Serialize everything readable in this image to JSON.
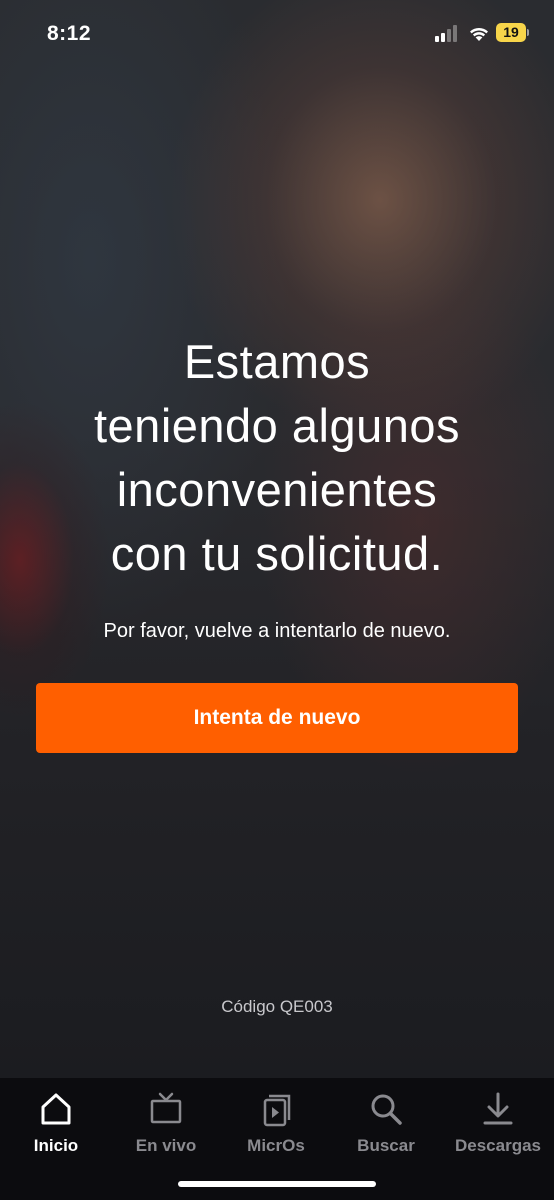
{
  "status_bar": {
    "time": "8:12",
    "battery_level": "19",
    "battery_color": "#f7d54a",
    "icons": [
      "cellular-signal-icon",
      "wifi-icon",
      "battery-icon"
    ]
  },
  "error": {
    "headline_lines": [
      "Estamos",
      "teniendo algunos",
      "inconvenientes",
      "con tu solicitud."
    ],
    "message": "Por favor, vuelve a intentarlo de nuevo.",
    "retry_label": "Intenta de nuevo",
    "code": "Código QE003"
  },
  "accent_color": "#ff5f00",
  "tabs": [
    {
      "label": "Inicio",
      "icon": "home-icon",
      "active": true
    },
    {
      "label": "En vivo",
      "icon": "tv-icon",
      "active": false
    },
    {
      "label": "MicrOs",
      "icon": "shorts-icon",
      "active": false
    },
    {
      "label": "Buscar",
      "icon": "search-icon",
      "active": false
    },
    {
      "label": "Descargas",
      "icon": "download-icon",
      "active": false
    }
  ]
}
